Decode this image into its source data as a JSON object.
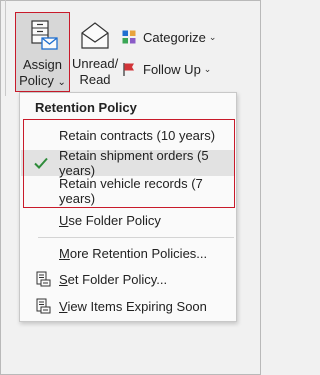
{
  "ribbon": {
    "assign_policy": {
      "line1": "Assign",
      "line2_text": "Policy",
      "line2_chevron": "⌄"
    },
    "unread_read": {
      "line1": "Unread/",
      "line2": "Read"
    },
    "categorize": {
      "label": "Categorize",
      "chevron": "⌄"
    },
    "follow_up": {
      "label": "Follow Up",
      "chevron": "⌄"
    }
  },
  "menu": {
    "header": "Retention Policy",
    "policies": [
      {
        "label": "Retain contracts (10 years)",
        "checked": false
      },
      {
        "label": "Retain shipment orders (5 years)",
        "checked": true
      },
      {
        "label": "Retain vehicle records (7 years)",
        "checked": false
      }
    ],
    "use_folder_policy": {
      "underline_char": "U",
      "rest": "se Folder Policy"
    },
    "more_policies": {
      "underline_char": "M",
      "rest": "ore Retention Policies..."
    },
    "set_folder_policy": {
      "underline_char": "S",
      "rest": "et Folder Policy..."
    },
    "view_expiring": {
      "underline_char": "V",
      "rest": "iew Items Expiring Soon"
    }
  },
  "colors": {
    "highlight_border": "#c81a2a",
    "check_green": "#2e8b3a",
    "flag_red": "#d13438",
    "envelope_blue": "#1f6fd0"
  }
}
